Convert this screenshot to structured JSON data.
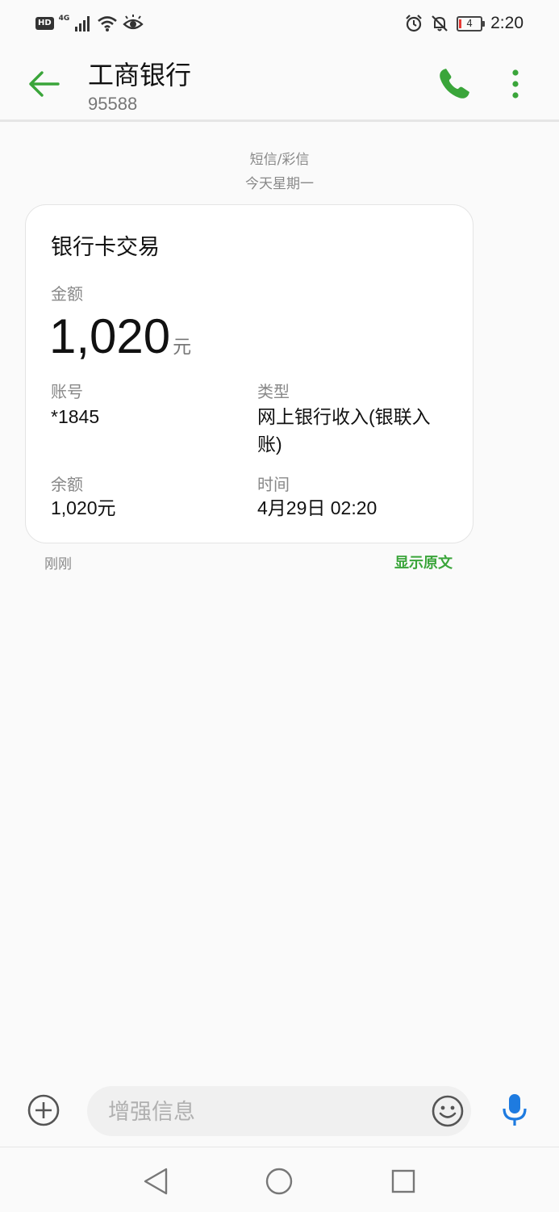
{
  "status_bar": {
    "hd_badge": "HD",
    "network_label": "4G",
    "battery_level": "4",
    "time": "2:20"
  },
  "header": {
    "title": "工商银行",
    "number": "95588"
  },
  "thread": {
    "message_type": "短信/彩信",
    "date_label": "今天星期一"
  },
  "card": {
    "title": "银行卡交易",
    "amount_label": "金额",
    "amount_value": "1,020",
    "amount_unit": "元",
    "account_label": "账号",
    "account_value": "*1845",
    "type_label": "类型",
    "type_value": "网上银行收入(银联入账)",
    "balance_label": "余额",
    "balance_value": "1,020元",
    "time_label": "时间",
    "time_value": "4月29日 02:20"
  },
  "footer": {
    "sent_time": "刚刚",
    "show_original": "显示原文"
  },
  "compose": {
    "placeholder": "增强信息"
  },
  "colors": {
    "accent_green": "#3aa53a",
    "mic_blue": "#1e7be0",
    "battery_low": "#e53935"
  },
  "icons": [
    "back-arrow-icon",
    "phone-icon",
    "more-vert-icon",
    "add-circle-icon",
    "emoji-icon",
    "microphone-icon",
    "nav-back-icon",
    "nav-home-icon",
    "nav-recents-icon"
  ]
}
